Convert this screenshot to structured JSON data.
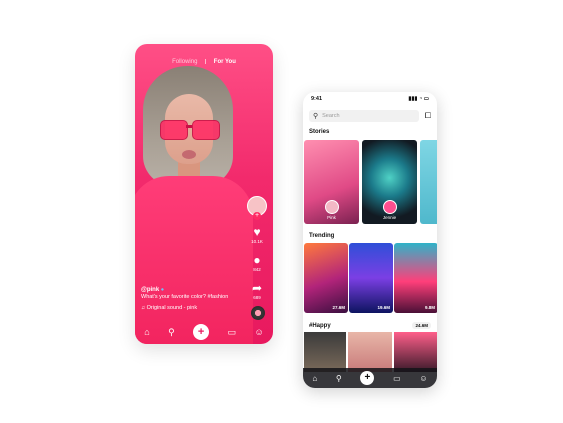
{
  "feed": {
    "tabs": [
      "Following",
      "For You"
    ],
    "actions": {
      "likes": "10.1K",
      "comments": "842",
      "shares": "689"
    },
    "caption": {
      "username": "@pink",
      "verified_icon": "verified-icon",
      "text": "What's your favorite color? #fashion",
      "sound": "Original sound - pink"
    },
    "nav_icons": [
      "home-icon",
      "search-icon",
      "plus-icon",
      "inbox-icon",
      "profile-icon"
    ]
  },
  "discover": {
    "status": {
      "time": "9:41"
    },
    "search": {
      "placeholder": "Search"
    },
    "stories_title": "Stories",
    "stories": [
      {
        "name": "Pink"
      },
      {
        "name": "Jennie"
      }
    ],
    "trending_title": "Trending",
    "trending": [
      {
        "views": "27.6M"
      },
      {
        "views": "19.6M"
      },
      {
        "views": "9.8M"
      }
    ],
    "happy_title": "#Happy",
    "happy_count": "24.6M",
    "nav_icons": [
      "home-icon",
      "search-icon",
      "plus-icon",
      "inbox-icon",
      "profile-icon"
    ]
  },
  "colors": {
    "accent": "#ff2b63",
    "feed_bg": "#f22a6c"
  }
}
